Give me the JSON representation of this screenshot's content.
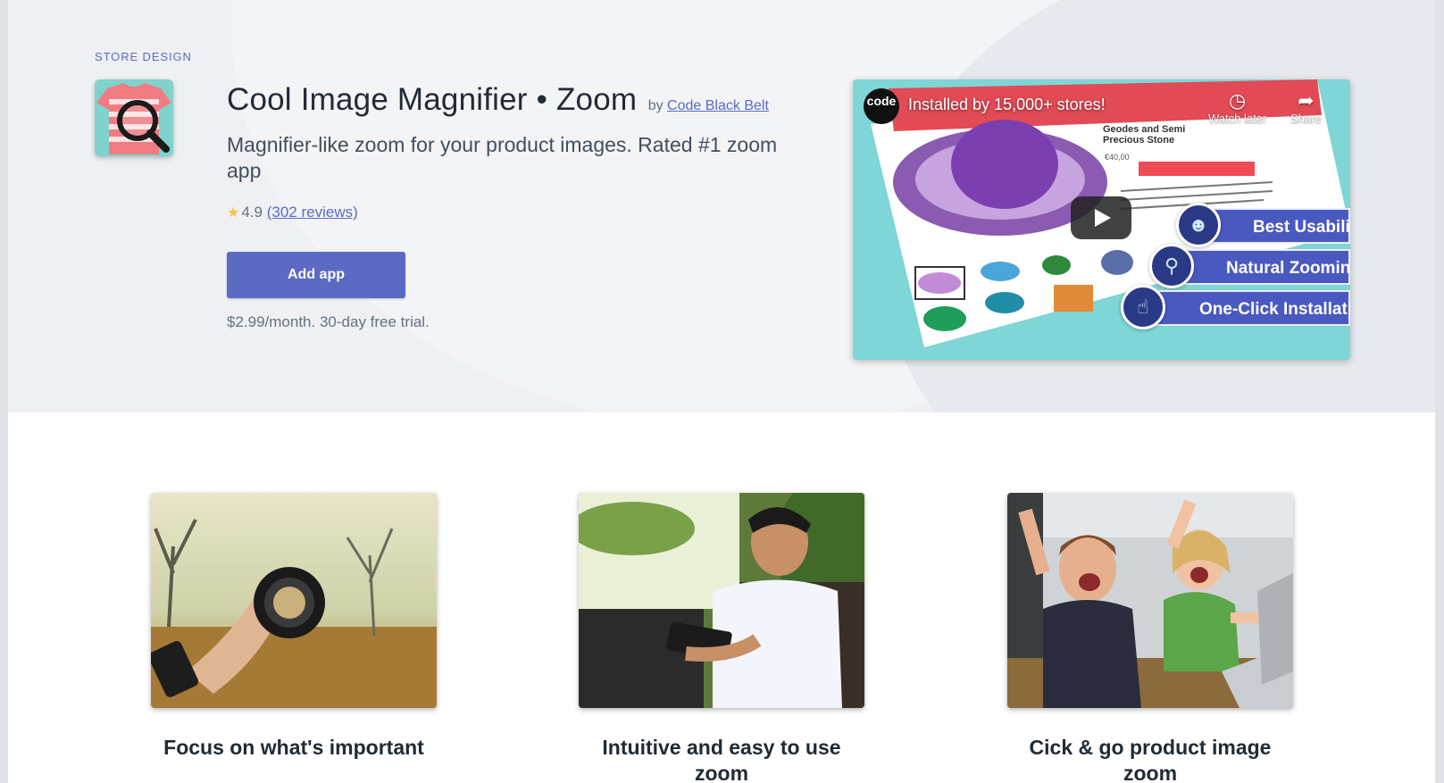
{
  "hero": {
    "category": "STORE DESIGN",
    "app_title": "Cool Image Magnifier • Zoom",
    "by": "by",
    "author": "Code Black Belt",
    "subtitle": "Magnifier-like zoom for your product images. Rated #1 zoom app",
    "rating_value": "4.9",
    "reviews": "(302 reviews)",
    "add_app_label": "Add app",
    "pricing": "$2.99/month. 30-day free trial."
  },
  "video": {
    "logo_text": "code",
    "title": "Installed by 15,000+ stores!",
    "watch_later": "Watch later",
    "share": "Share",
    "product_title": "Geodes and Semi Precious Stone",
    "product_price": "€40,00",
    "badges": [
      "Best Usability",
      "Natural Zooming",
      "One-Click Installation"
    ]
  },
  "features": [
    {
      "title": "Focus on what's important"
    },
    {
      "title": "Intuitive and easy to use zoom"
    },
    {
      "title": "Cick & go product image zoom"
    }
  ],
  "colors": {
    "accent": "#5c6ac4",
    "star": "#f6c344",
    "hero_bg": "#eef0f3"
  }
}
